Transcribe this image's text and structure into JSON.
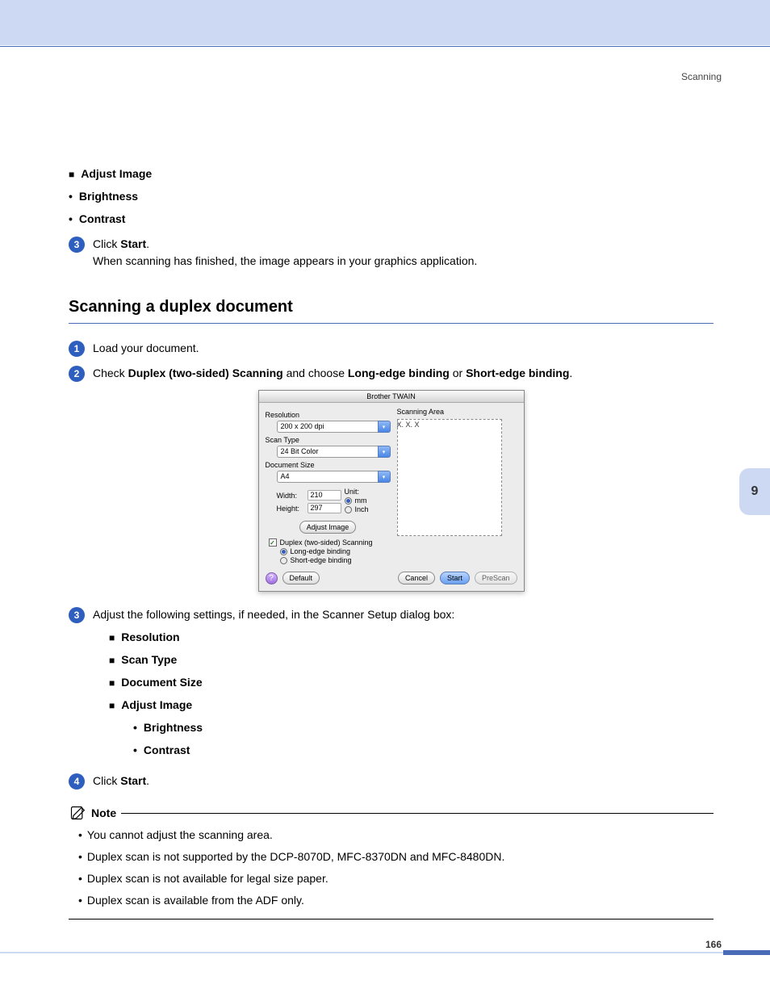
{
  "header": {
    "section": "Scanning"
  },
  "page_number": "166",
  "chapter_tab": "9",
  "top_continue": {
    "adjust_image": "Adjust Image",
    "brightness": "Brightness",
    "contrast": "Contrast",
    "step3_a": "Click ",
    "step3_b": "Start",
    "step3_c": ".",
    "step3_line2": "When scanning has finished, the image appears in your graphics application."
  },
  "section": {
    "title": "Scanning a duplex document"
  },
  "steps": {
    "s1": "Load your document.",
    "s2_a": "Check ",
    "s2_b": "Duplex (two-sided) Scanning",
    "s2_c": " and choose ",
    "s2_d": "Long-edge binding",
    "s2_e": " or ",
    "s2_f": "Short-edge binding",
    "s2_g": ".",
    "s3": "Adjust the following settings, if needed, in the Scanner Setup dialog box:",
    "s4_a": "Click ",
    "s4_b": "Start",
    "s4_c": "."
  },
  "settings_list": {
    "resolution": "Resolution",
    "scan_type": "Scan Type",
    "doc_size": "Document Size",
    "adjust_image": "Adjust Image",
    "brightness": "Brightness",
    "contrast": "Contrast"
  },
  "dialog": {
    "title": "Brother TWAIN",
    "version": "X. X. X",
    "resolution_label": "Resolution",
    "resolution_value": "200 x 200 dpi",
    "scantype_label": "Scan Type",
    "scantype_value": "24 Bit Color",
    "docsize_label": "Document Size",
    "docsize_value": "A4",
    "width_label": "Width:",
    "width_value": "210",
    "height_label": "Height:",
    "height_value": "297",
    "unit_label": "Unit:",
    "unit_mm": "mm",
    "unit_inch": "Inch",
    "adjust_image_btn": "Adjust Image",
    "duplex_cb": "Duplex (two-sided) Scanning",
    "long_edge": "Long-edge binding",
    "short_edge": "Short-edge binding",
    "scanning_area": "Scanning Area",
    "default_btn": "Default",
    "cancel_btn": "Cancel",
    "start_btn": "Start",
    "prescan_btn": "PreScan",
    "help_btn": "?"
  },
  "note": {
    "title": "Note",
    "n1": "You cannot adjust the scanning area.",
    "n2": "Duplex scan is not supported by the DCP-8070D, MFC-8370DN and MFC-8480DN.",
    "n3": "Duplex scan is not available for legal size paper.",
    "n4": "Duplex scan is available from the ADF only."
  }
}
